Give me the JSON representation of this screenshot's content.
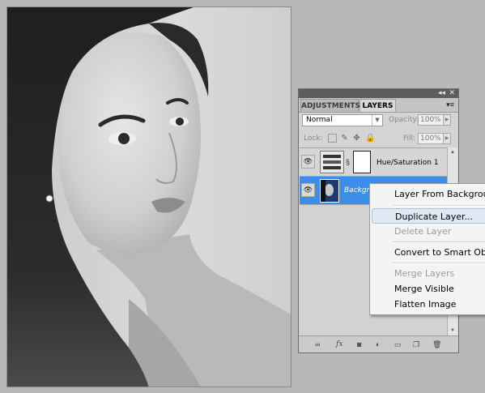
{
  "panel": {
    "tabs": [
      "ADJUSTMENTS",
      "LAYERS"
    ],
    "active_tab": "LAYERS",
    "collapse_glyph": "◂◂",
    "close_glyph": "✕",
    "menu_glyph": "▾≡",
    "blend_mode": "Normal",
    "opacity_label": "Opacity:",
    "opacity_value": "100%",
    "lock_label": "Lock:",
    "fill_label": "Fill:",
    "fill_value": "100%",
    "layers": [
      {
        "name": "Hue/Saturation 1",
        "type": "adjustment",
        "visible": true,
        "selected": false
      },
      {
        "name": "Background",
        "type": "pixel",
        "visible": true,
        "selected": true
      }
    ],
    "bottom_icons": [
      "link-icon",
      "fx-icon",
      "mask-icon",
      "adjustment-icon",
      "folder-icon",
      "new-layer-icon",
      "trash-icon"
    ],
    "bottom_glyphs": {
      "link": "∞",
      "fx": "fx",
      "mask": "◙",
      "adjustment": "◐",
      "folder": "▭",
      "new": "❐",
      "trash": "🗑"
    }
  },
  "context_menu": {
    "items": [
      {
        "label": "Layer From Background...",
        "enabled": true
      },
      {
        "label": "Duplicate Layer...",
        "enabled": true,
        "hover": true
      },
      {
        "label": "Delete Layer",
        "enabled": false
      },
      {
        "label": "Convert to Smart Object",
        "enabled": true
      },
      {
        "label": "Merge Layers",
        "enabled": false
      },
      {
        "label": "Merge Visible",
        "enabled": true
      },
      {
        "label": "Flatten Image",
        "enabled": true
      }
    ]
  },
  "colors": {
    "workspace": "#b8b8b8",
    "selected_layer": "#3d8ee6",
    "menu_hover": "#dfe9f4"
  }
}
